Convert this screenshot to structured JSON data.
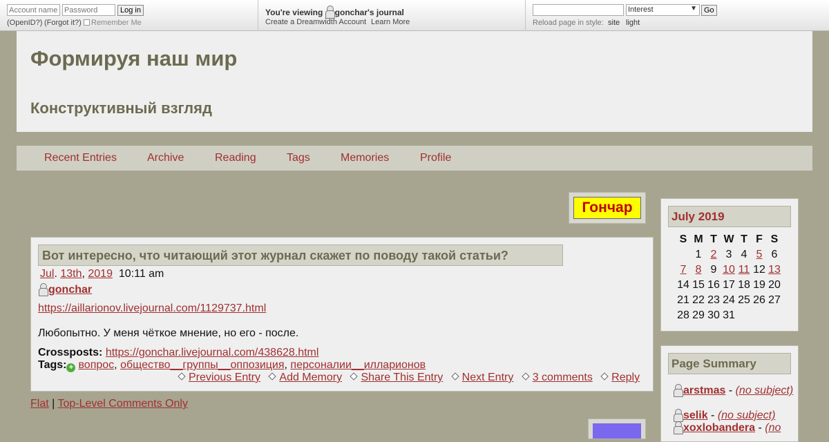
{
  "topbar": {
    "login": {
      "account_placeholder": "Account name:",
      "password_placeholder": "Password",
      "login_button": "Log in",
      "openid_link": "(OpenID?)",
      "forgot_link": "(Forgot it?)",
      "remember_me": "Remember Me"
    },
    "viewing": {
      "label": "You're viewing",
      "journal": "gonchar's journal",
      "create_account": "Create a Dreamwidth Account",
      "learn_more": "Learn More"
    },
    "search": {
      "input_value": "",
      "select_value": "Interest",
      "go_button": "Go",
      "reload_label": "Reload page in style:",
      "style_site": "site",
      "style_light": "light"
    }
  },
  "header": {
    "title": "Формируя наш мир",
    "subtitle": "Конструктивный взгляд"
  },
  "nav": {
    "items": [
      "Recent Entries",
      "Archive",
      "Reading",
      "Tags",
      "Memories",
      "Profile"
    ]
  },
  "userpic": {
    "text": "Гончар",
    "bg_color": "#ffff00",
    "text_color": "#c00000"
  },
  "entry": {
    "title": "Вот интересно, что читающий этот журнал скажет по поводу такой статьи?",
    "date": {
      "month": "Jul",
      "day": "13th",
      "year": "2019",
      "time": "10:11 am"
    },
    "author": "gonchar",
    "link": "https://aillarionov.livejournal.com/1129737.html",
    "body": "Любопытно. У меня чёткое мнение, но его - после.",
    "crossposts_label": "Crossposts:",
    "crossposts_url": "https://gonchar.livejournal.com/438628.html",
    "tags_label": "Tags:",
    "tags": [
      "вопрос",
      "общество__группы__оппозиция",
      "персоналии__илларионов"
    ],
    "actions": {
      "previous": "Previous Entry",
      "memory": "Add Memory",
      "share": "Share This Entry",
      "next": "Next Entry",
      "comments": "3 comments",
      "reply": "Reply"
    }
  },
  "comment_links": {
    "flat": "Flat",
    "separator": "|",
    "top_level": "Top-Level Comments Only"
  },
  "calendar": {
    "title": "July 2019",
    "weekdays": [
      "S",
      "M",
      "T",
      "W",
      "T",
      "F",
      "S"
    ],
    "weeks": [
      [
        "",
        "1",
        "2",
        "3",
        "4",
        "5",
        "6"
      ],
      [
        "7",
        "8",
        "9",
        "10",
        "11",
        "12",
        "13"
      ],
      [
        "14",
        "15",
        "16",
        "17",
        "18",
        "19",
        "20"
      ],
      [
        "21",
        "22",
        "23",
        "24",
        "25",
        "26",
        "27"
      ],
      [
        "28",
        "29",
        "30",
        "31",
        "",
        "",
        ""
      ]
    ],
    "linked_days": [
      "2",
      "5",
      "7",
      "8",
      "10",
      "11",
      "13"
    ]
  },
  "summary": {
    "title": "Page Summary",
    "items": [
      {
        "user": "arstmas",
        "subject": "(no subject)"
      },
      {
        "user": "selik",
        "subject": "(no subject)"
      },
      {
        "user": "xoxlobandera",
        "subject": "(no"
      }
    ]
  },
  "colors": {
    "background": "#a7a590",
    "link": "#a12f2f",
    "heading": "#6c6b51",
    "panel": "#efefef"
  }
}
